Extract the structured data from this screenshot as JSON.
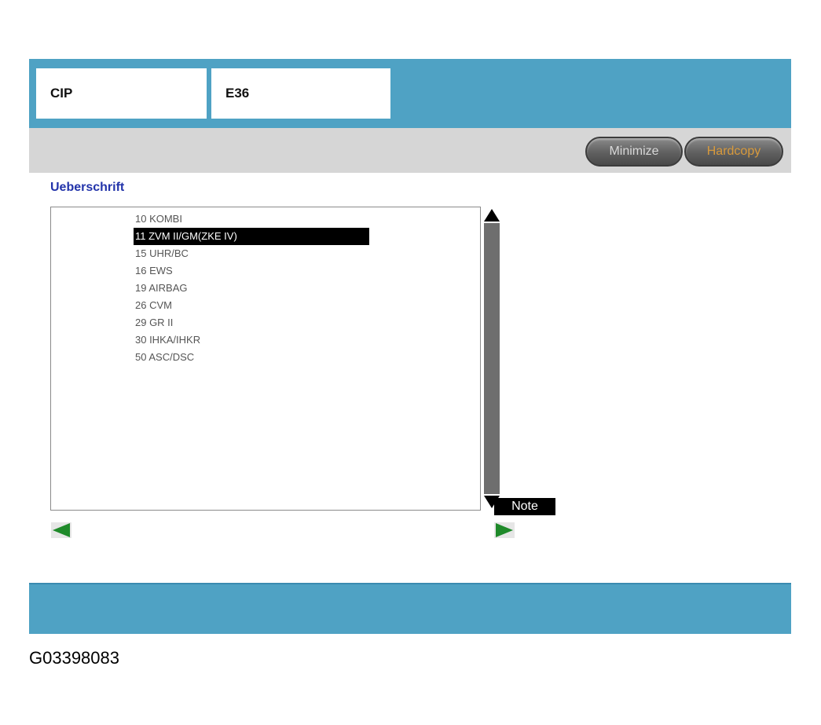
{
  "header": {
    "system_label": "CIP",
    "model_label": "E36"
  },
  "toolbar": {
    "minimize_label": "Minimize",
    "hardcopy_label": "Hardcopy"
  },
  "content": {
    "heading": "Ueberschrift",
    "list": {
      "selected_index": 1,
      "items": [
        {
          "label": "10 KOMBI"
        },
        {
          "label": "11 ZVM II/GM(ZKE IV)"
        },
        {
          "label": "15 UHR/BC"
        },
        {
          "label": "16 EWS"
        },
        {
          "label": "19 AIRBAG"
        },
        {
          "label": "26 CVM"
        },
        {
          "label": "29 GR II"
        },
        {
          "label": "30 IHKA/IHKR"
        },
        {
          "label": "50 ASC/DSC"
        }
      ]
    },
    "note_label": "Note"
  },
  "caption": "G03398083",
  "colors": {
    "banner": "#4fa2c4",
    "toolbar": "#d6d6d6",
    "heading": "#2233aa",
    "hardcopy_text": "#d89a3c",
    "nav_arrow": "#1f8a2a"
  },
  "icons": {
    "scroll_up": "triangle-up-icon",
    "scroll_down": "triangle-down-icon",
    "prev": "arrow-left-icon",
    "next": "arrow-right-icon"
  }
}
